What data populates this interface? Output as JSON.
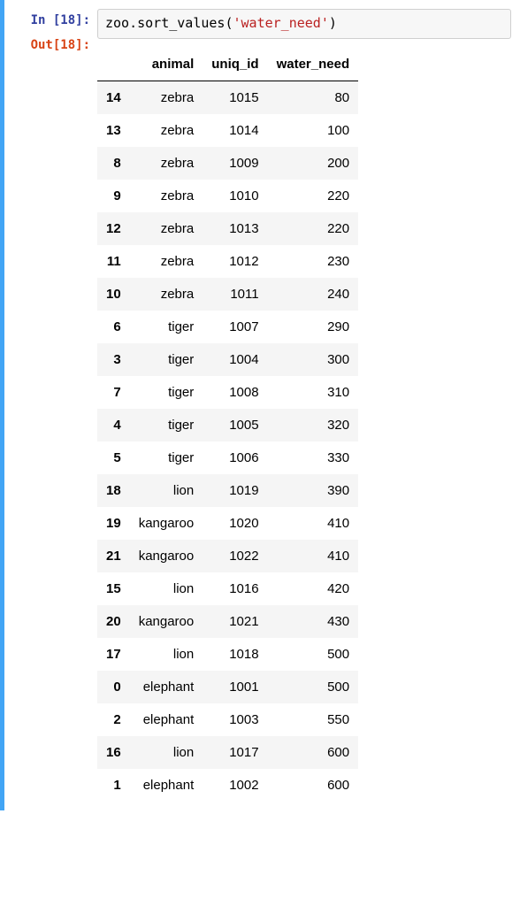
{
  "prompts": {
    "in_label": "In [18]:",
    "out_label": "Out[18]:"
  },
  "code": {
    "prefix": "zoo.sort_values(",
    "string_open": "'",
    "string_val": "water_need",
    "string_close": "'",
    "suffix": ")"
  },
  "table": {
    "columns": [
      "animal",
      "uniq_id",
      "water_need"
    ],
    "rows": [
      {
        "idx": "14",
        "animal": "zebra",
        "uniq_id": "1015",
        "water_need": "80"
      },
      {
        "idx": "13",
        "animal": "zebra",
        "uniq_id": "1014",
        "water_need": "100"
      },
      {
        "idx": "8",
        "animal": "zebra",
        "uniq_id": "1009",
        "water_need": "200"
      },
      {
        "idx": "9",
        "animal": "zebra",
        "uniq_id": "1010",
        "water_need": "220"
      },
      {
        "idx": "12",
        "animal": "zebra",
        "uniq_id": "1013",
        "water_need": "220"
      },
      {
        "idx": "11",
        "animal": "zebra",
        "uniq_id": "1012",
        "water_need": "230"
      },
      {
        "idx": "10",
        "animal": "zebra",
        "uniq_id": "1011",
        "water_need": "240"
      },
      {
        "idx": "6",
        "animal": "tiger",
        "uniq_id": "1007",
        "water_need": "290"
      },
      {
        "idx": "3",
        "animal": "tiger",
        "uniq_id": "1004",
        "water_need": "300"
      },
      {
        "idx": "7",
        "animal": "tiger",
        "uniq_id": "1008",
        "water_need": "310"
      },
      {
        "idx": "4",
        "animal": "tiger",
        "uniq_id": "1005",
        "water_need": "320"
      },
      {
        "idx": "5",
        "animal": "tiger",
        "uniq_id": "1006",
        "water_need": "330"
      },
      {
        "idx": "18",
        "animal": "lion",
        "uniq_id": "1019",
        "water_need": "390"
      },
      {
        "idx": "19",
        "animal": "kangaroo",
        "uniq_id": "1020",
        "water_need": "410"
      },
      {
        "idx": "21",
        "animal": "kangaroo",
        "uniq_id": "1022",
        "water_need": "410"
      },
      {
        "idx": "15",
        "animal": "lion",
        "uniq_id": "1016",
        "water_need": "420"
      },
      {
        "idx": "20",
        "animal": "kangaroo",
        "uniq_id": "1021",
        "water_need": "430"
      },
      {
        "idx": "17",
        "animal": "lion",
        "uniq_id": "1018",
        "water_need": "500"
      },
      {
        "idx": "0",
        "animal": "elephant",
        "uniq_id": "1001",
        "water_need": "500"
      },
      {
        "idx": "2",
        "animal": "elephant",
        "uniq_id": "1003",
        "water_need": "550"
      },
      {
        "idx": "16",
        "animal": "lion",
        "uniq_id": "1017",
        "water_need": "600"
      },
      {
        "idx": "1",
        "animal": "elephant",
        "uniq_id": "1002",
        "water_need": "600"
      }
    ]
  }
}
